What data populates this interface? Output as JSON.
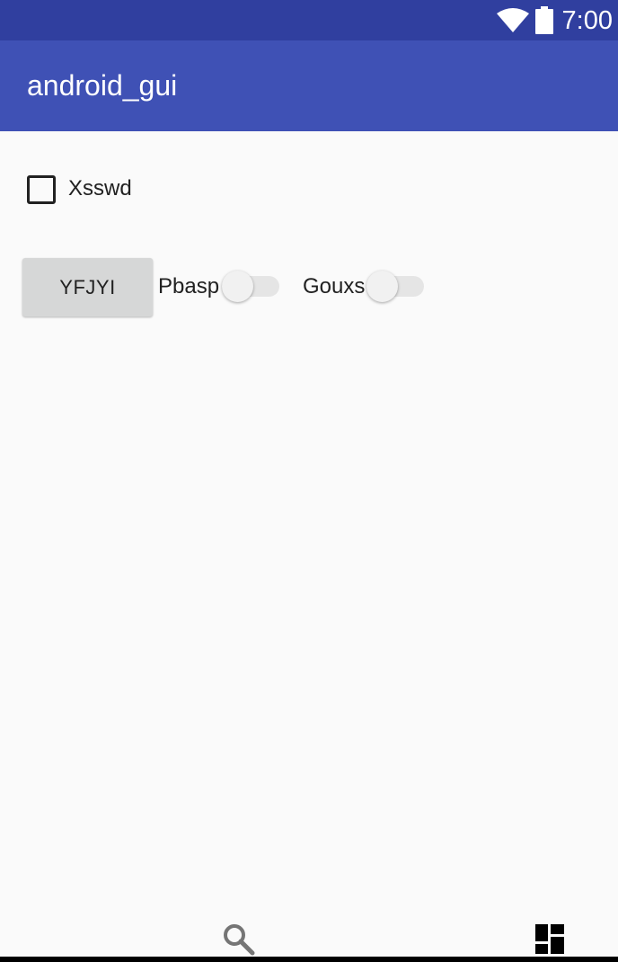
{
  "status_bar": {
    "time": "7:00",
    "icons": [
      "wifi-icon",
      "battery-icon"
    ],
    "color": "#303f9f"
  },
  "app_bar": {
    "title": "android_gui",
    "color": "#3f51b5"
  },
  "content": {
    "checkbox": {
      "label": "Xsswd",
      "checked": false
    },
    "button": {
      "label": "YFJYI"
    },
    "switches": [
      {
        "label": "Pbasp",
        "on": false
      },
      {
        "label": "Gouxs",
        "on": false
      }
    ]
  },
  "bottom_bar": {
    "icons": [
      "search-icon",
      "dashboard-icon"
    ]
  }
}
